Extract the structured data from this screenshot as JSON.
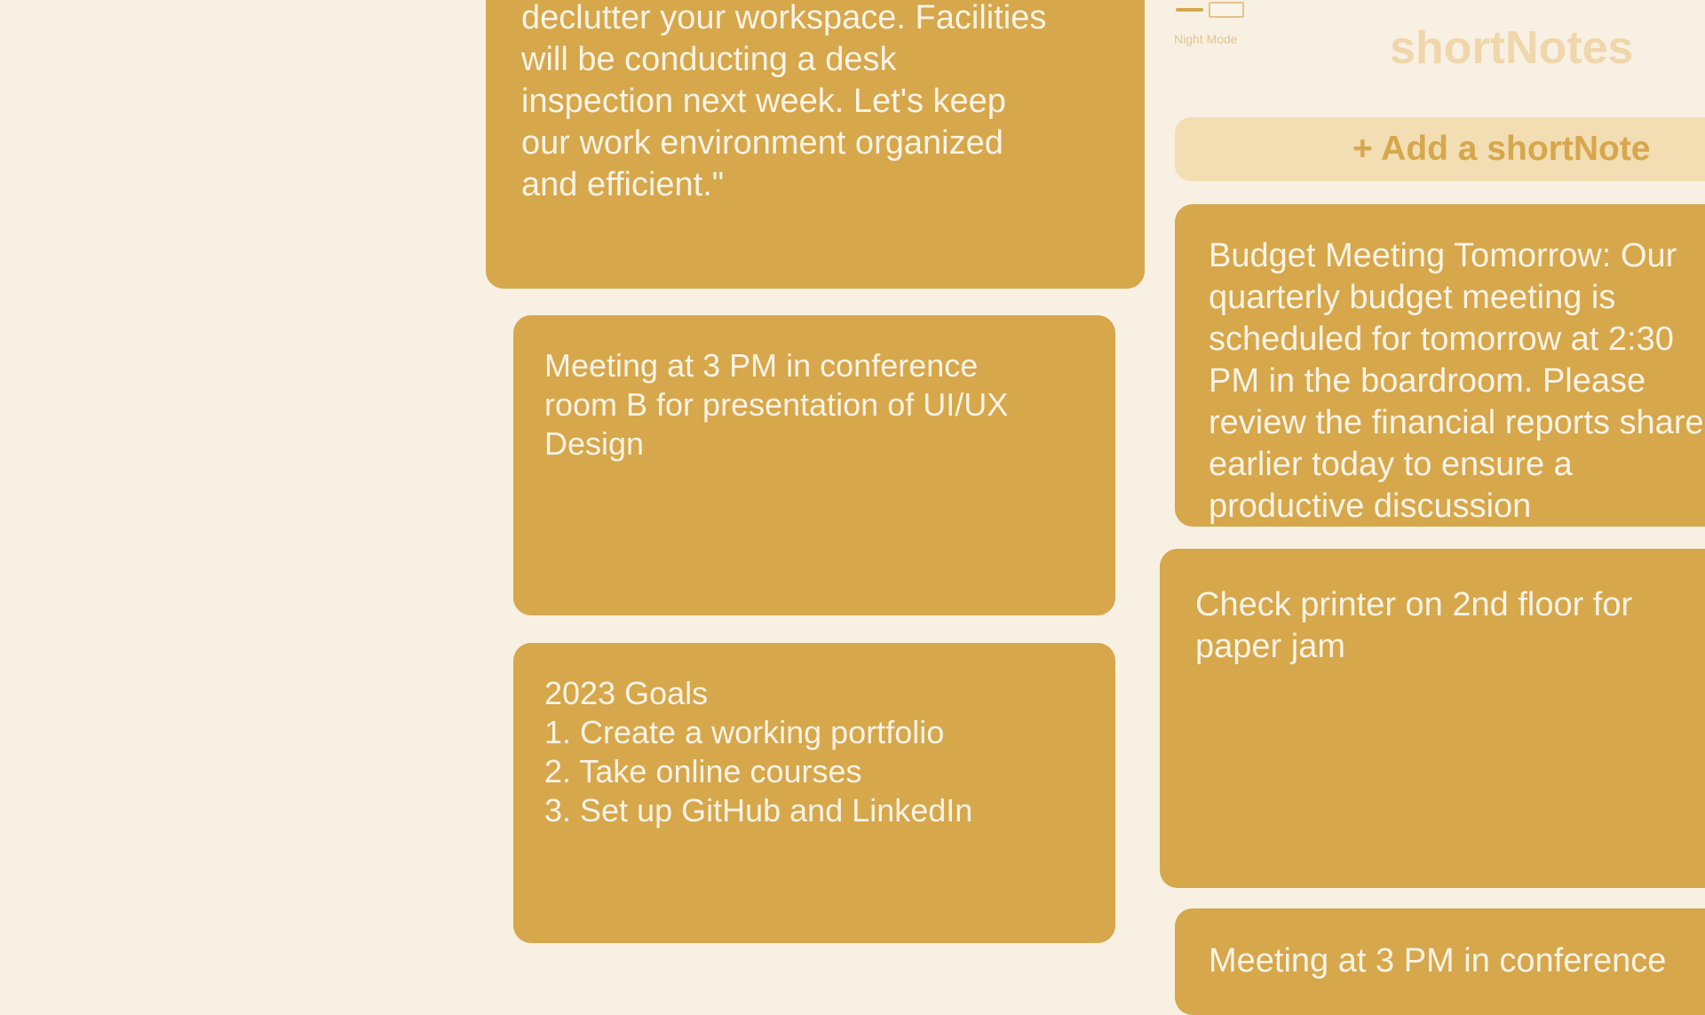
{
  "header": {
    "night_mode_label": "Night Mode",
    "app_title": "shortNotes",
    "add_note_label": "+ Add a shortNote"
  },
  "notes": [
    {
      "text": "declutter your workspace. Facilities\nwill be conducting a desk\ninspection next week. Let's keep\nour work environment organized\nand efficient.\""
    },
    {
      "text": "Meeting at 3 PM in conference\nroom B for presentation of UI/UX\nDesign"
    },
    {
      "text": "2023 Goals\n1. Create a working portfolio\n2. Take online courses\n3. Set up GitHub and LinkedIn"
    },
    {
      "text": "Budget Meeting Tomorrow: Our\nquarterly budget meeting is\nscheduled for tomorrow at 2:30\nPM in the boardroom. Please\nreview the financial reports shared\nearlier today to ensure a\nproductive discussion"
    },
    {
      "text": "Check printer on 2nd floor for\npaper jam"
    },
    {
      "text": "Meeting at 3 PM in conference"
    }
  ],
  "colors": {
    "background": "#f8f0e3",
    "note": "#d6a74b",
    "note_text": "#fbf3e6",
    "add_button_bg": "#f3ddb3",
    "title": "#efd6ab"
  }
}
